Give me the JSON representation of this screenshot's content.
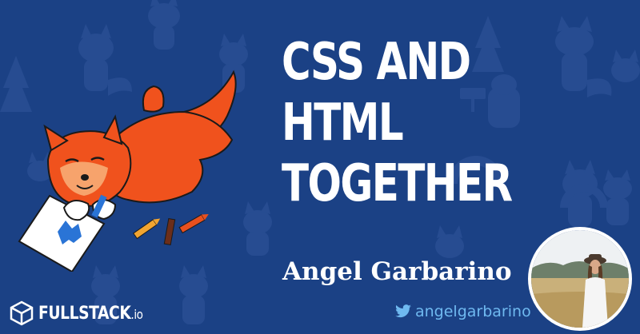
{
  "title": {
    "line1": "CSS AND",
    "line2": "HTML",
    "line3": "TOGETHER"
  },
  "author": {
    "name": "Angel Garbarino",
    "twitter_handle": "angelgarbarino"
  },
  "brand": {
    "name": "FULLSTACK",
    "suffix": ".io"
  },
  "icons": {
    "twitter": "twitter-bird-icon",
    "logo": "cube-logo-icon"
  },
  "colors": {
    "background": "#1b4185",
    "fox": "#f0521d",
    "twitter_text": "#6fb9f0",
    "title_text": "#ffffff"
  }
}
